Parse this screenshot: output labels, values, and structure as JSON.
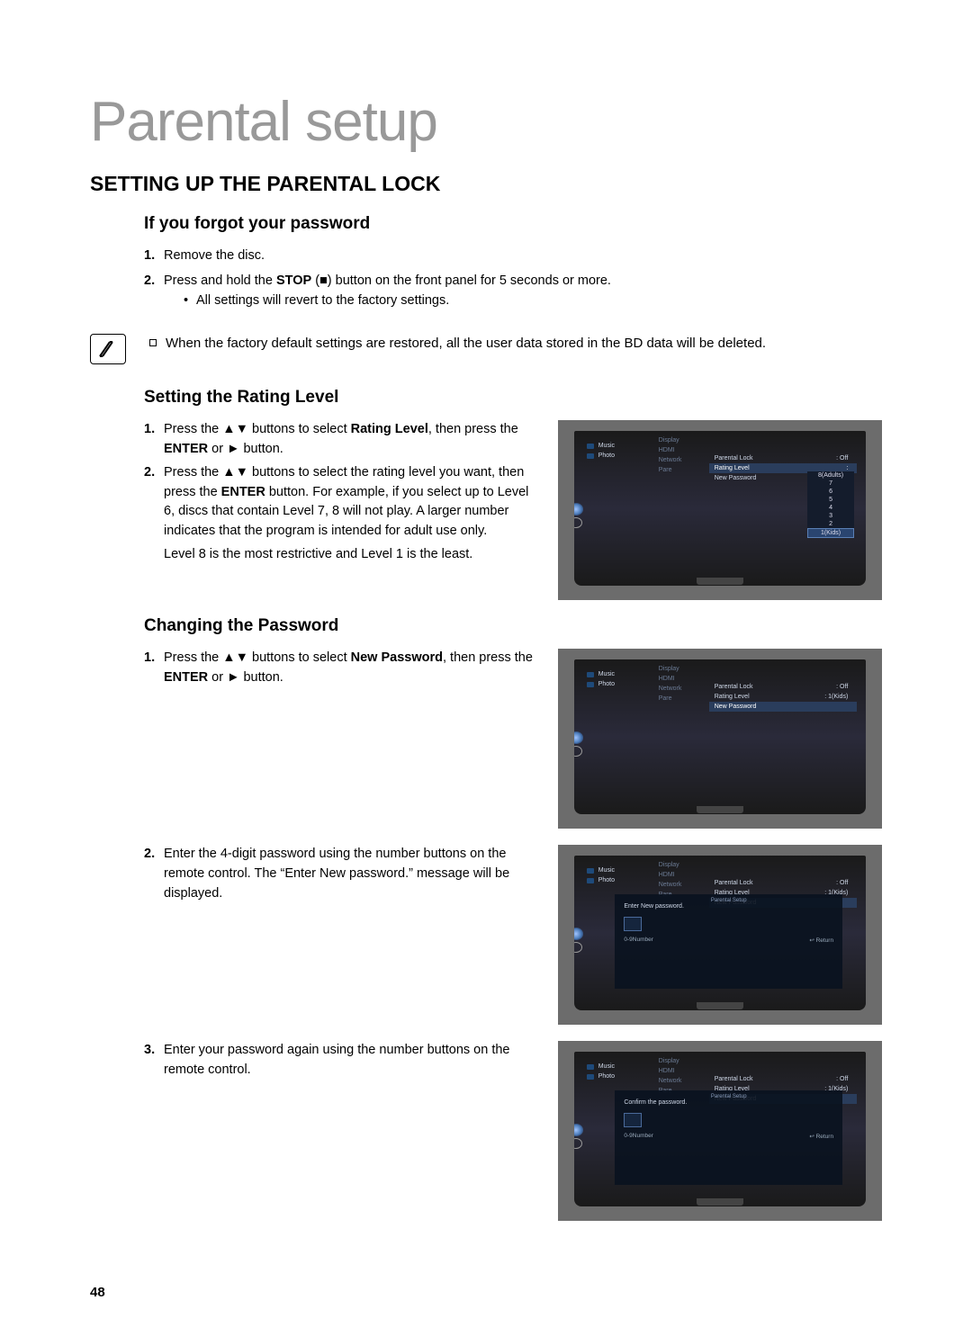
{
  "page_number": "48",
  "title": "Parental setup",
  "section": "SETTING UP THE PARENTAL LOCK",
  "sub_forgot": {
    "heading": "If you forgot your password",
    "steps": [
      {
        "num": "1.",
        "text": "Remove the disc."
      },
      {
        "num": "2.",
        "text_pre": "Press and hold the ",
        "bold": "STOP",
        "text_mid": " (",
        "icon": "■",
        "text_post": ") button on the front panel for 5 seconds or more."
      }
    ],
    "bullet": "All settings will revert to the factory settings."
  },
  "note": "When the factory default settings are restored, all the user data stored in the BD data will be deleted.",
  "sub_rating": {
    "heading": "Setting the Rating Level",
    "step1": {
      "num": "1.",
      "pre": "Press the ",
      "icons": "▲▼",
      "mid": " buttons to select ",
      "bold": "Rating Level",
      "mid2": ", then press the ",
      "bold2": "ENTER",
      "mid3": " or ",
      "icon2": "►",
      "post": " button."
    },
    "step2": {
      "num": "2.",
      "pre": "Press the ",
      "icons": "▲▼",
      "mid": " buttons to select the rating level you want, then press the ",
      "bold": "ENTER",
      "post": " button. For example, if you select up to Level 6, discs that contain Level 7, 8 will not play. A larger number indicates that the program is intended for adult use only."
    },
    "tail": "Level 8 is the most restrictive and Level 1 is the least."
  },
  "sub_password": {
    "heading": "Changing the Password",
    "step1": {
      "num": "1.",
      "pre": "Press the ",
      "icons": "▲▼",
      "mid": " buttons to select ",
      "bold": "New Password",
      "mid2": ", then press the ",
      "bold2": "ENTER",
      "mid3": " or ",
      "icon2": "►",
      "post": " button."
    },
    "step2": {
      "num": "2.",
      "text": "Enter the 4-digit password using the number buttons on the remote control. The “Enter New password.” message will be displayed."
    },
    "step3": {
      "num": "3.",
      "text": "Enter your password again using the number buttons on the remote control."
    }
  },
  "screenshots": {
    "common": {
      "left": [
        "Music",
        "Photo"
      ],
      "mid": [
        "Display",
        "HDMI",
        "Network",
        "Pare"
      ],
      "parental_lock_label": "Parental Lock",
      "parental_lock_val": ": Off",
      "rating_level_label": "Rating Level",
      "new_password_label": "New Password"
    },
    "shot1": {
      "rating_level_val": ":",
      "dropdown": [
        "8(Adults)",
        "7",
        "6",
        "5",
        "4",
        "3",
        "2",
        "1(Kids)"
      ]
    },
    "shot2": {
      "rating_level_val": ": 1(Kids)"
    },
    "shot3": {
      "rating_level_val": ": 1(Kids)",
      "overlay_title": "Parental Setup",
      "overlay_msg": "Enter New password.",
      "overlay_number": "0-9Number",
      "overlay_return": "↩ Return"
    },
    "shot4": {
      "rating_level_val": ": 1(Kids)",
      "overlay_title": "Parental Setup",
      "overlay_msg": "Confirm the password.",
      "overlay_number": "0-9Number",
      "overlay_return": "↩ Return"
    }
  }
}
